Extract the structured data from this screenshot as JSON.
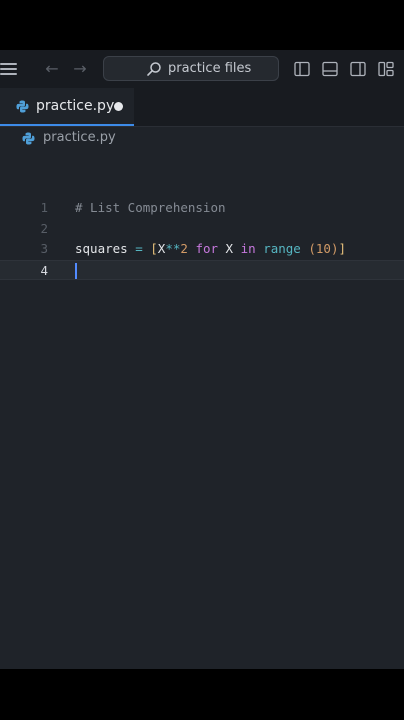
{
  "window": {
    "search_label": "practice files"
  },
  "tab": {
    "filename": "practice.py",
    "unsaved": true
  },
  "breadcrumb": {
    "filename": "practice.py"
  },
  "editor": {
    "lines": [
      {
        "number": "1",
        "tokens": [
          {
            "t": "# List Comprehension",
            "c": "comment"
          }
        ]
      },
      {
        "number": "2",
        "tokens": []
      },
      {
        "number": "3",
        "tokens": [
          {
            "t": "squares",
            "c": "var"
          },
          {
            "t": " = ",
            "c": "op"
          },
          {
            "t": "[",
            "c": "bracket"
          },
          {
            "t": "X",
            "c": "var"
          },
          {
            "t": "**",
            "c": "op"
          },
          {
            "t": "2",
            "c": "num"
          },
          {
            "t": " ",
            "c": "var"
          },
          {
            "t": "for",
            "c": "kw"
          },
          {
            "t": " X ",
            "c": "var"
          },
          {
            "t": "in",
            "c": "kw"
          },
          {
            "t": " ",
            "c": "var"
          },
          {
            "t": "range",
            "c": "fn"
          },
          {
            "t": " ",
            "c": "var"
          },
          {
            "t": "(",
            "c": "paren"
          },
          {
            "t": "10",
            "c": "num"
          },
          {
            "t": ")",
            "c": "paren"
          },
          {
            "t": "]",
            "c": "bracket"
          }
        ]
      },
      {
        "number": "4",
        "tokens": [],
        "current": true
      }
    ]
  },
  "colors": {
    "accent": "#3d8be8",
    "background": "#1f2329",
    "keyword": "#c678dd",
    "number": "#d19a66"
  },
  "icons": [
    "menu-icon",
    "back-arrow-icon",
    "forward-arrow-icon",
    "search-icon",
    "toggle-primary-sidebar-icon",
    "toggle-panel-icon",
    "toggle-secondary-sidebar-icon",
    "customize-layout-icon",
    "python-file-icon",
    "unsaved-dot-icon",
    "text-cursor-icon"
  ]
}
